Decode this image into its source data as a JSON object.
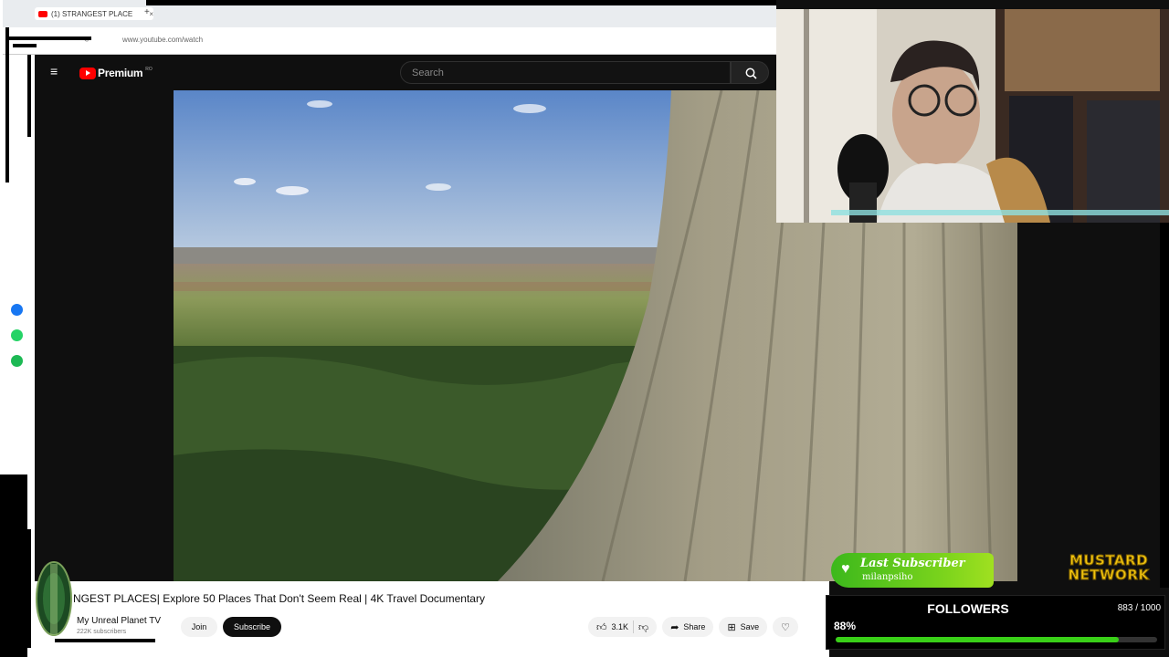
{
  "browser": {
    "tab_title": "(1) STRANGEST PLACE",
    "tab_close": "×",
    "new_tab": "+",
    "url": "www.youtube.com/watch"
  },
  "youtube": {
    "brand": "Premium",
    "region": "RO",
    "search_placeholder": "Search"
  },
  "video": {
    "title": "NGEST PLACES| Explore 50 Places That Don't Seem Real | 4K Travel Documentary",
    "channel": "My Unreal Planet TV",
    "subscribers": "222K subscribers",
    "join_label": "Join",
    "subscribe_label": "Subscribe",
    "likes": "3.1K",
    "share_label": "Share",
    "save_label": "Save"
  },
  "overlay": {
    "last_subscriber_title": "Last Subscriber",
    "last_subscriber_name": "milanpsiho",
    "brand_line1": "MUSTARD",
    "brand_line2": "NETWORK",
    "followers_label": "FOLLOWERS",
    "followers_count": "883 / 1000",
    "followers_percent": "88%",
    "followers_progress": 0.88
  },
  "colors": {
    "youtube_red": "#ff0000",
    "progress_green": "#39d018",
    "mustard_yellow": "#f1c40f"
  }
}
